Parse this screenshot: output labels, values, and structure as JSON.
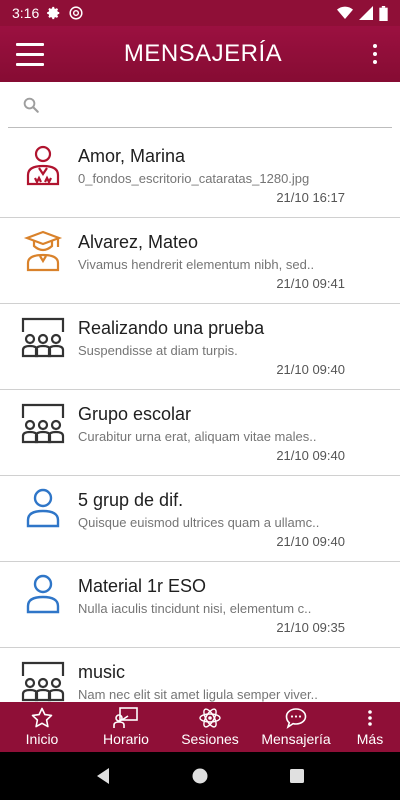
{
  "status_bar": {
    "time": "3:16"
  },
  "app_bar": {
    "title": "MENSAJERÍA"
  },
  "search": {
    "placeholder": ""
  },
  "conversations": [
    {
      "name": "Amor, Marina",
      "snippet": "0_fondos_escritorio_cataratas_1280.jpg",
      "time": "21/10 16:17",
      "icon": "teacher-icon"
    },
    {
      "name": "Alvarez, Mateo",
      "snippet": "Vivamus hendrerit elementum nibh, sed..",
      "time": "21/10 09:41",
      "icon": "student-icon"
    },
    {
      "name": "Realizando una prueba",
      "snippet": "Suspendisse at diam turpis.",
      "time": "21/10 09:40",
      "icon": "group-icon"
    },
    {
      "name": "Grupo escolar",
      "snippet": "Curabitur urna erat, aliquam vitae males..",
      "time": "21/10 09:40",
      "icon": "group-icon"
    },
    {
      "name": "5 grup de dif.",
      "snippet": "Quisque euismod ultrices quam a ullamc..",
      "time": "21/10 09:40",
      "icon": "person-icon"
    },
    {
      "name": "Material 1r ESO",
      "snippet": "Nulla iaculis tincidunt nisi, elementum c..",
      "time": "21/10 09:35",
      "icon": "person-icon"
    },
    {
      "name": "music",
      "snippet": "Nam nec elit sit amet ligula semper viver..",
      "time": "",
      "icon": "group-icon"
    }
  ],
  "bottom_nav": [
    {
      "label": "Inicio",
      "icon": "star-icon"
    },
    {
      "label": "Horario",
      "icon": "schedule-icon"
    },
    {
      "label": "Sesiones",
      "icon": "atom-icon"
    },
    {
      "label": "Mensajería",
      "icon": "chat-icon"
    },
    {
      "label": "Más",
      "icon": "more-icon"
    }
  ],
  "colors": {
    "primary": "#8f0f37",
    "teacher": "#b0142f",
    "student": "#d9822b",
    "group": "#333333",
    "person": "#2f76c8"
  }
}
